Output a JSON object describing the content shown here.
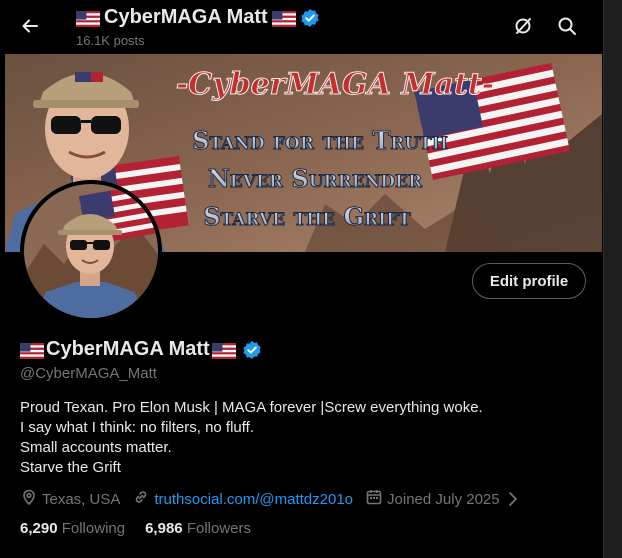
{
  "header": {
    "title": "CyberMAGA Matt",
    "posts_count": "16.1K posts"
  },
  "banner": {
    "title": "-CyberMAGA Matt-",
    "line1": "Stand for the Truth",
    "line2": "Never Surrender",
    "line3": "Starve the Grift"
  },
  "profile": {
    "edit_label": "Edit profile",
    "name": "CyberMAGA Matt",
    "handle": "@CyberMAGA_Matt",
    "bio": [
      "Proud Texan. Pro Elon Musk | MAGA forever |Screw everything woke.",
      "I say what I think: no filters, no fluff.",
      "Small accounts matter.",
      "Starve the Grift"
    ],
    "location": "Texas, USA",
    "website": "truthsocial.com/@mattdz201o",
    "joined": "Joined July 2025",
    "following_count": "6,290",
    "following_label": "Following",
    "followers_count": "6,986",
    "followers_label": "Followers"
  },
  "icons": {
    "back": "arrow-left-icon",
    "grok": "slash-circle-icon",
    "search": "search-icon",
    "location": "location-pin-icon",
    "link": "link-icon",
    "calendar": "calendar-icon",
    "chevron": "chevron-right-icon",
    "verified": "verified-badge-icon",
    "flag": "us-flag-icon"
  },
  "colors": {
    "background": "#000000",
    "text": "#e7e9ea",
    "muted": "#71767b",
    "link": "#1d9bf0",
    "verified": "#1d9bf0"
  }
}
